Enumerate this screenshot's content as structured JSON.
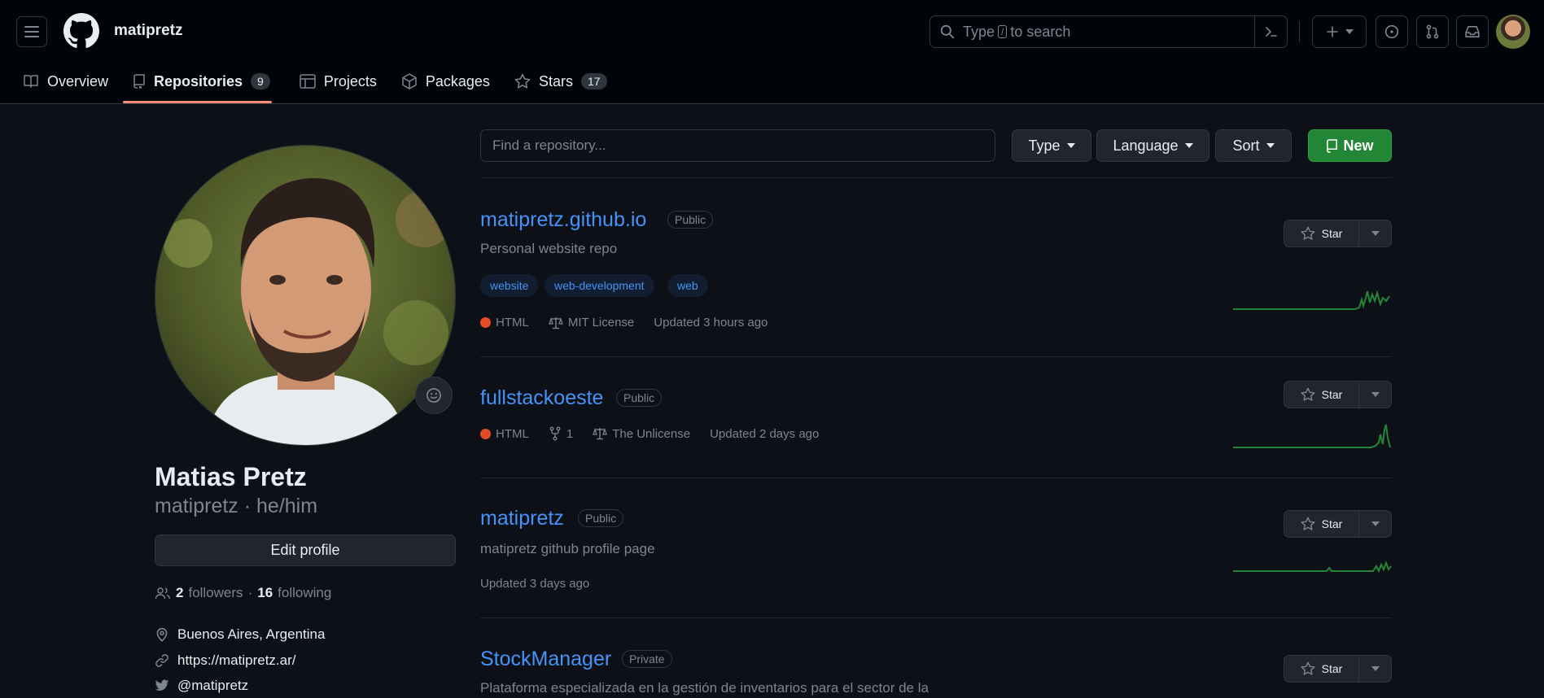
{
  "header": {
    "username": "matipretz",
    "search_placeholder_pre": "Type",
    "search_key": "/",
    "search_placeholder_post": "to search"
  },
  "nav": {
    "tabs": [
      {
        "label": "Overview",
        "icon": "book-icon"
      },
      {
        "label": "Repositories",
        "icon": "repo-icon",
        "count": "9",
        "selected": true
      },
      {
        "label": "Projects",
        "icon": "table-icon"
      },
      {
        "label": "Packages",
        "icon": "package-icon"
      },
      {
        "label": "Stars",
        "icon": "star-icon",
        "count": "17"
      }
    ]
  },
  "profile": {
    "name": "Matias Pretz",
    "handle": "matipretz · he/him",
    "edit_label": "Edit profile",
    "followers_count": "2",
    "followers_label": "followers",
    "sep": "·",
    "following_count": "16",
    "following_label": "following",
    "location": "Buenos Aires, Argentina",
    "website": "https://matipretz.ar/",
    "twitter": "@matipretz"
  },
  "filters": {
    "find_placeholder": "Find a repository...",
    "type_label": "Type",
    "language_label": "Language",
    "sort_label": "Sort",
    "new_label": "New"
  },
  "repos": [
    {
      "name": "matipretz.github.io",
      "visibility": "Public",
      "description": "Personal website repo",
      "topics": [
        "website",
        "web-development",
        "web"
      ],
      "language": "HTML",
      "license": "MIT License",
      "updated": "Updated 3 hours ago",
      "star_label": "Star"
    },
    {
      "name": "fullstackoeste",
      "visibility": "Public",
      "language": "HTML",
      "forks": "1",
      "license": "The Unlicense",
      "updated": "Updated 2 days ago",
      "star_label": "Star"
    },
    {
      "name": "matipretz",
      "visibility": "Public",
      "description": "matipretz github profile page",
      "updated": "Updated 3 days ago",
      "star_label": "Star"
    },
    {
      "name": "StockManager",
      "visibility": "Private",
      "description": "Plataforma especializada en la gestión de inventarios para el sector de la",
      "star_label": "Star"
    }
  ],
  "colors": {
    "bg": "#0d1117",
    "link": "#4493f8",
    "html_lang": "#e34c26",
    "new_button": "#238636",
    "tab_underline": "#fd8c73",
    "sparkline": "#238636"
  }
}
